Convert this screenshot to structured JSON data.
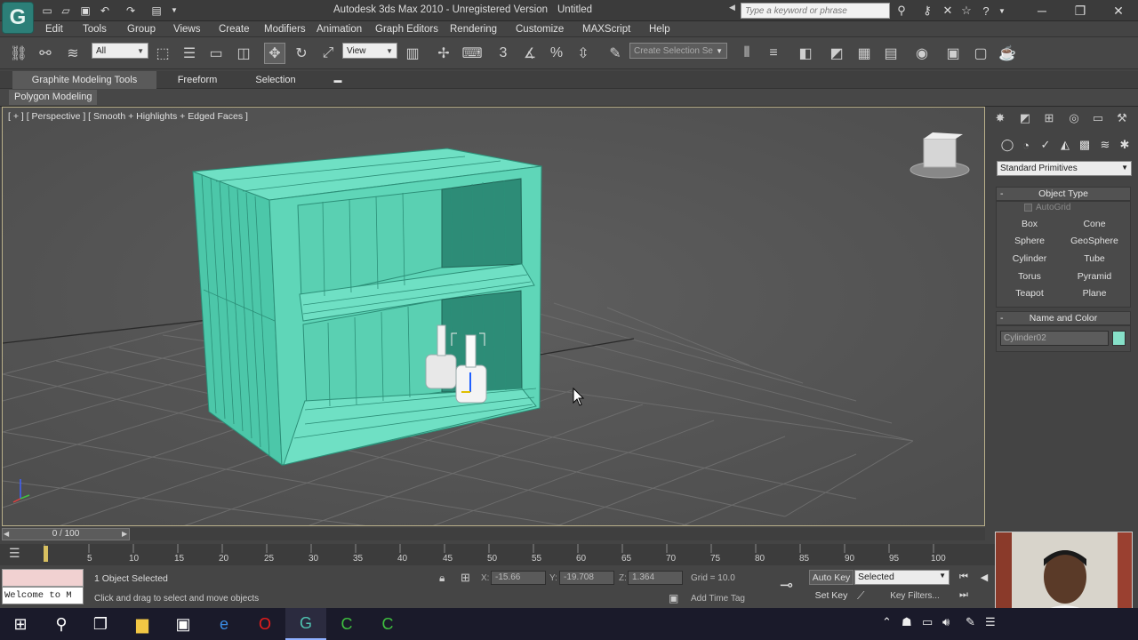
{
  "titlebar": {
    "app_title": "Autodesk 3ds Max  2010   -  Unregistered Version",
    "doc_title": "Untitled",
    "search_placeholder": "Type a keyword or phrase"
  },
  "menu": [
    "Edit",
    "Tools",
    "Group",
    "Views",
    "Create",
    "Modifiers",
    "Animation",
    "Graph Editors",
    "Rendering",
    "Customize",
    "MAXScript",
    "Help"
  ],
  "toolbar": {
    "selection_filter": "All",
    "reference_coord": "View",
    "named_selection": "Create Selection Se"
  },
  "ribbon": {
    "tabs": [
      "Graphite Modeling Tools",
      "Freeform",
      "Selection"
    ],
    "sub": "Polygon Modeling"
  },
  "viewport": {
    "label": "[ + ] [ Perspective ] [ Smooth + Highlights + Edged Faces ]"
  },
  "command_panel": {
    "category": "Standard Primitives",
    "object_type_title": "Object Type",
    "autogrid": "AutoGrid",
    "primitives": [
      "Box",
      "Cone",
      "Sphere",
      "GeoSphere",
      "Cylinder",
      "Tube",
      "Torus",
      "Pyramid",
      "Teapot",
      "Plane"
    ],
    "name_color_title": "Name and Color",
    "object_name": "Cylinder02",
    "object_color": "#86e0c8"
  },
  "timeline": {
    "frame": "0 / 100",
    "ticks": [
      "0",
      "5",
      "10",
      "15",
      "20",
      "25",
      "30",
      "35",
      "40",
      "45",
      "50",
      "55",
      "60",
      "65",
      "70",
      "75",
      "80",
      "85",
      "90",
      "95",
      "100"
    ]
  },
  "status": {
    "selection": "1 Object Selected",
    "prompt": "Click and drag to select and move objects",
    "welcome": "Welcome to M",
    "x_label": "X:",
    "x": "-15.66",
    "y_label": "Y:",
    "y": "-19.708",
    "z_label": "Z:",
    "z": "1.364",
    "grid": "Grid = 10.0",
    "add_time_tag": "Add Time Tag",
    "auto_key": "Auto Key",
    "set_key": "Set Key",
    "key_mode": "Selected",
    "key_filters": "Key Filters..."
  },
  "colors": {
    "object_teal": "#5fd6b8",
    "viewport_bg": "#575757",
    "accent": "#2c7f78"
  }
}
